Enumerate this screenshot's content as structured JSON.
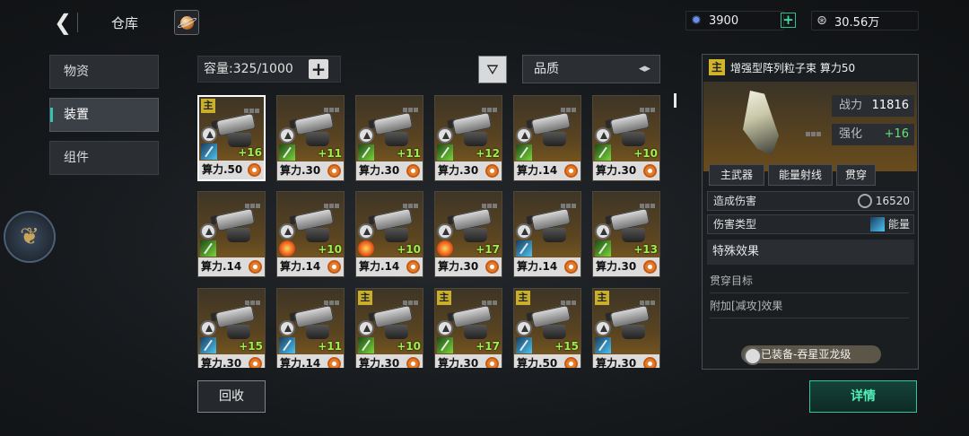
{
  "header": {
    "title": "仓库"
  },
  "resources": {
    "crystal": "3900",
    "coins": "30.56万"
  },
  "sidebar": {
    "items": [
      "物资",
      "装置",
      "组件"
    ],
    "active_index": 1
  },
  "inventory": {
    "capacity": "容量:325/1000",
    "sort_label": "品质",
    "items": [
      {
        "power": "算力.50",
        "main": "主",
        "enh": "+16",
        "elem": "blue"
      },
      {
        "power": "算力.30",
        "main": "",
        "enh": "+11",
        "elem": "green"
      },
      {
        "power": "算力.30",
        "main": "",
        "enh": "+11",
        "elem": "green"
      },
      {
        "power": "算力.30",
        "main": "",
        "enh": "+12",
        "elem": "green"
      },
      {
        "power": "算力.14",
        "main": "",
        "enh": "",
        "elem": "green"
      },
      {
        "power": "算力.30",
        "main": "",
        "enh": "+10",
        "elem": "green"
      },
      {
        "power": "算力.14",
        "main": "",
        "enh": "",
        "elem": "green"
      },
      {
        "power": "算力.14",
        "main": "",
        "enh": "+10",
        "elem": "fire"
      },
      {
        "power": "算力.14",
        "main": "",
        "enh": "+10",
        "elem": "fire"
      },
      {
        "power": "算力.30",
        "main": "",
        "enh": "+17",
        "elem": "fire"
      },
      {
        "power": "算力.14",
        "main": "",
        "enh": "",
        "elem": "blue"
      },
      {
        "power": "算力.30",
        "main": "",
        "enh": "+13",
        "elem": "green"
      },
      {
        "power": "算力.30",
        "main": "",
        "enh": "+15",
        "elem": "blue"
      },
      {
        "power": "算力.14",
        "main": "",
        "enh": "+11",
        "elem": "blue"
      },
      {
        "power": "算力.30",
        "main": "主",
        "enh": "+10",
        "elem": "green"
      },
      {
        "power": "算力.30",
        "main": "主",
        "enh": "+17",
        "elem": "green"
      },
      {
        "power": "算力.50",
        "main": "主",
        "enh": "+15",
        "elem": "blue"
      },
      {
        "power": "算力.30",
        "main": "主",
        "enh": "",
        "elem": "blue"
      }
    ]
  },
  "detail": {
    "main_tag": "主",
    "title": "增强型阵列粒子束  算力50",
    "combat_label": "战力",
    "combat_value": "11816",
    "enhance_label": "强化",
    "enhance_value": "+16",
    "chips": [
      "主武器",
      "能量射线",
      "贯穿"
    ],
    "damage_label": "造成伤害",
    "damage_value": "16520",
    "damage_type_label": "伤害类型",
    "damage_type_value": "能量",
    "special_title": "特殊效果",
    "effects": [
      "贯穿目标",
      "附加[减攻]效果"
    ],
    "equipped": "已装备-吞星亚龙级"
  },
  "buttons": {
    "recycle": "回收",
    "details": "详情"
  }
}
